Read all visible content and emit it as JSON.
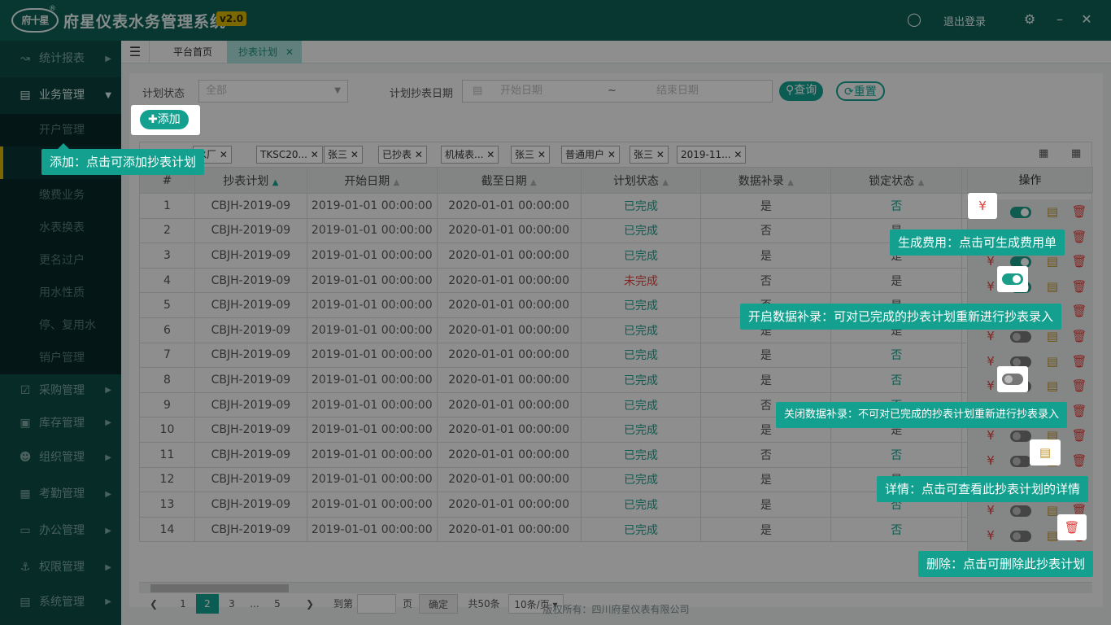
{
  "app": {
    "title": "府星仪表水务管理系统",
    "version": "v2.0",
    "logo_text": "府十星",
    "logout": "退出登录"
  },
  "sidebar": {
    "items": [
      {
        "label": "统计报表"
      },
      {
        "label": "业务管理"
      },
      {
        "label": "采购管理"
      },
      {
        "label": "库存管理"
      },
      {
        "label": "组织管理"
      },
      {
        "label": "考勤管理"
      },
      {
        "label": "办公管理"
      },
      {
        "label": "权限管理"
      },
      {
        "label": "系统管理"
      }
    ],
    "sub": [
      "开户管理",
      "抄表计划",
      "缴费业务",
      "水表换表",
      "更名过户",
      "用水性质",
      "停、复用水",
      "销户管理"
    ]
  },
  "tabs": [
    "平台首页",
    "抄表计划"
  ],
  "filters": {
    "status_label": "计划状态",
    "status_value": "全部",
    "date_label": "计划抄表日期",
    "start_placeholder": "开始日期",
    "end_placeholder": "结束日期",
    "sep": "~",
    "query": "查询",
    "reset": "重置",
    "add": "添加"
  },
  "chips": [
    "水厂",
    "TKSC20...",
    "张三",
    "已抄表",
    "机械表...",
    "张三",
    "普通用户",
    "张三",
    "2019-11..."
  ],
  "table": {
    "headers": [
      "#",
      "抄表计划",
      "开始日期",
      "截至日期",
      "计划状态",
      "数据补录",
      "锁定状态",
      "操作"
    ],
    "rows": [
      [
        "1",
        "CBJH-2019-09",
        "2019-01-01  00:00:00",
        "2020-01-01  00:00:00",
        "已完成",
        "是",
        "否"
      ],
      [
        "2",
        "CBJH-2019-09",
        "2019-01-01  00:00:00",
        "2020-01-01  00:00:00",
        "已完成",
        "否",
        "是"
      ],
      [
        "3",
        "CBJH-2019-09",
        "2019-01-01  00:00:00",
        "2020-01-01  00:00:00",
        "已完成",
        "是",
        "是"
      ],
      [
        "4",
        "CBJH-2019-09",
        "2019-01-01  00:00:00",
        "2020-01-01  00:00:00",
        "未完成",
        "否",
        "是"
      ],
      [
        "5",
        "CBJH-2019-09",
        "2019-01-01  00:00:00",
        "2020-01-01  00:00:00",
        "已完成",
        "否",
        "是"
      ],
      [
        "6",
        "CBJH-2019-09",
        "2019-01-01  00:00:00",
        "2020-01-01  00:00:00",
        "已完成",
        "是",
        "是"
      ],
      [
        "7",
        "CBJH-2019-09",
        "2019-01-01  00:00:00",
        "2020-01-01  00:00:00",
        "已完成",
        "是",
        "否"
      ],
      [
        "8",
        "CBJH-2019-09",
        "2019-01-01  00:00:00",
        "2020-01-01  00:00:00",
        "已完成",
        "是",
        "否"
      ],
      [
        "9",
        "CBJH-2019-09",
        "2019-01-01  00:00:00",
        "2020-01-01  00:00:00",
        "已完成",
        "否",
        "否"
      ],
      [
        "10",
        "CBJH-2019-09",
        "2019-01-01  00:00:00",
        "2020-01-01  00:00:00",
        "已完成",
        "是",
        "是"
      ],
      [
        "11",
        "CBJH-2019-09",
        "2019-01-01  00:00:00",
        "2020-01-01  00:00:00",
        "已完成",
        "否",
        "否"
      ],
      [
        "12",
        "CBJH-2019-09",
        "2019-01-01  00:00:00",
        "2020-01-01  00:00:00",
        "已完成",
        "是",
        "是"
      ],
      [
        "13",
        "CBJH-2019-09",
        "2019-01-01  00:00:00",
        "2020-01-01  00:00:00",
        "已完成",
        "是",
        "否"
      ],
      [
        "14",
        "CBJH-2019-09",
        "2019-01-01  00:00:00",
        "2020-01-01  00:00:00",
        "已完成",
        "是",
        "否"
      ]
    ]
  },
  "pager": {
    "pages": [
      "1",
      "2",
      "3",
      "...",
      "5"
    ],
    "goto": "到第",
    "page": "页",
    "confirm": "确定",
    "total": "共50条",
    "size": "10条/页"
  },
  "tips": {
    "add": "添加：点击可添加抄表计划",
    "fee": "生成费用：点击可生成费用单",
    "open": "开启数据补录：可对已完成的抄表计划重新进行抄表录入",
    "close": "关闭数据补录：不可对已完成的抄表计划重新进行抄表录入",
    "detail": "详情：点击可查看此抄表计划的详情",
    "del": "删除：点击可删除此抄表计划"
  },
  "footer": "版权所有：四川府星仪表有限公司",
  "colors": {
    "primary": "#13a08f",
    "done": "#1a9e8a",
    "undone": "#e0403c",
    "topbar": "#0f5e55"
  }
}
